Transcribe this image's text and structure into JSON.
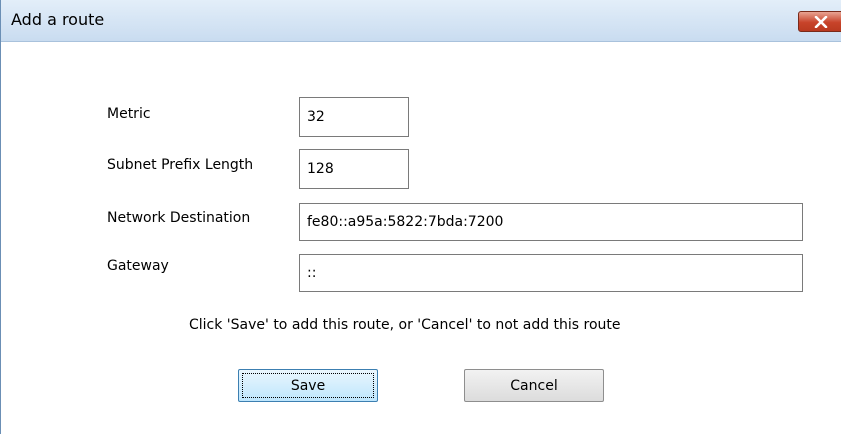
{
  "window": {
    "title": "Add a route",
    "close_icon": "close-x-icon"
  },
  "form": {
    "metric": {
      "label": "Metric",
      "value": "32"
    },
    "subnet_prefix_length": {
      "label": "Subnet Prefix Length",
      "value": "128"
    },
    "network_destination": {
      "label": "Network Destination",
      "value": "fe80::a95a:5822:7bda:7200"
    },
    "gateway": {
      "label": "Gateway",
      "value": "::"
    }
  },
  "hint": "Click 'Save' to add this route, or 'Cancel' to not add this route",
  "buttons": {
    "save": "Save",
    "cancel": "Cancel"
  },
  "colors": {
    "close_button": "#c8432a",
    "titlebar": "#d6e5f5",
    "default_button": "#bee6fd"
  }
}
